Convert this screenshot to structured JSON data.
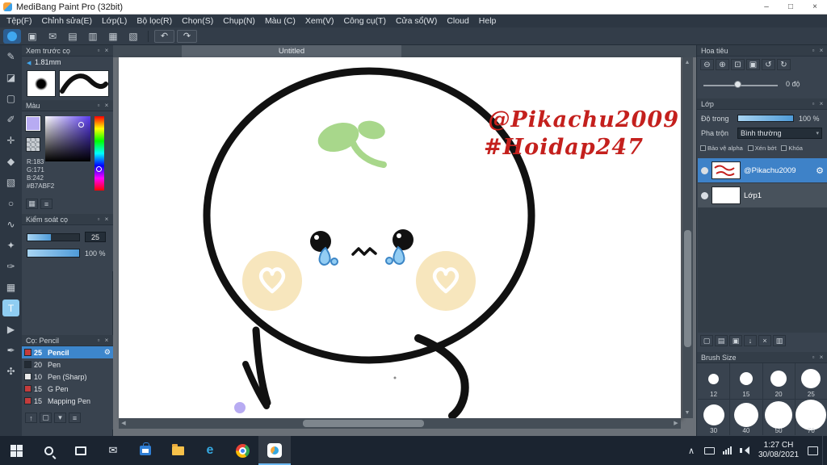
{
  "app": {
    "title": "MediBang Paint Pro (32bit)"
  },
  "icons": {
    "min": "–",
    "max": "□",
    "close": "×",
    "popout": "▫",
    "save": "▣",
    "chat": "✉",
    "doc": "▤",
    "doc2": "▥",
    "grid": "▦",
    "material": "▧",
    "undo": "↶",
    "redo": "↷",
    "collapse": "◀",
    "palette": "▦",
    "sliders": "≡",
    "gear": "⚙",
    "zoom_out": "⊖",
    "zoom_in": "⊕",
    "zoom_fit": "⊡",
    "zoom_reset": "▣",
    "rotate_ccw": "↺",
    "rotate_cw": "↻",
    "dd_arrow": "▾",
    "l_new": "▢",
    "l_folder": "▤",
    "l_dup": "▣",
    "l_merge": "↓",
    "l_trash": "×",
    "l_menu": "▥",
    "b_up": "↑",
    "b_new": "▢",
    "b_menu": "▾",
    "b_list": "≡",
    "mail": "✉",
    "edge": "e",
    "chevron": "∧",
    "sb_left": "◀",
    "sb_right": "▶",
    "sb_up": "▲",
    "sb_down": "▼"
  },
  "menubar": {
    "items": [
      "Tệp(F)",
      "Chỉnh sửa(E)",
      "Lớp(L)",
      "Bộ lọc(R)",
      "Chọn(S)",
      "Chụp(N)",
      "Màu (C)",
      "Xem(V)",
      "Công cụ(T)",
      "Cửa sổ(W)",
      "Cloud",
      "Help"
    ]
  },
  "toolstrip": {
    "tools": [
      "✎",
      "◪",
      "▢",
      "✐",
      "✛",
      "◆",
      "▧",
      "○",
      "∿",
      "✦",
      "✑",
      "▦",
      "T",
      "▶",
      "✒",
      "✣"
    ]
  },
  "left": {
    "brush_preview": {
      "title": "Xem trước cọ",
      "size": "1.81mm"
    },
    "color": {
      "title": "Màu",
      "r": "R:183",
      "g": "G:171",
      "b": "B:242",
      "hex": "#B7ABF2"
    },
    "brush_control": {
      "title": "Kiểm soát cọ",
      "size": "25",
      "opacity": "100 %"
    },
    "brushes": {
      "title": "Cọ: Pencil",
      "items": [
        {
          "size": "25",
          "name": "Pencil",
          "chip": "#c43c3c",
          "selected": true
        },
        {
          "size": "20",
          "name": "Pen",
          "chip": "#232b34",
          "selected": false
        },
        {
          "size": "10",
          "name": "Pen (Sharp)",
          "chip": "#e9e9e9",
          "selected": false
        },
        {
          "size": "15",
          "name": "G Pen",
          "chip": "#c43c3c",
          "selected": false
        },
        {
          "size": "15",
          "name": "Mapping Pen",
          "chip": "#c43c3c",
          "selected": false
        }
      ]
    }
  },
  "canvas": {
    "tab": "Untitled",
    "annotations": [
      "@Pikachu2009",
      "#Hoidap247"
    ]
  },
  "right": {
    "navigator": {
      "title": "Hoa tiêu",
      "rotation": "0 độ"
    },
    "layers": {
      "title": "Lớp",
      "opacity_label": "Độ trong",
      "opacity_value": "100 %",
      "blend_label": "Pha trộn",
      "blend_value": "Bình thường",
      "checks": [
        "Bảo vệ alpha",
        "Xén bớt",
        "Khóa"
      ],
      "items": [
        {
          "name": "@Pikachu2009",
          "selected": true
        },
        {
          "name": "Lớp1",
          "selected": false
        }
      ]
    },
    "brush_size": {
      "title": "Brush Size",
      "sizes": [
        "12",
        "15",
        "20",
        "25",
        "30",
        "40",
        "50",
        "70"
      ]
    }
  },
  "taskbar": {
    "time": "1:27 CH",
    "date": "30/08/2021"
  },
  "colors": {
    "accent_blue": "#3fa7f0",
    "selection_blue": "#3d86cc",
    "foreground_color": "#b7abf2",
    "annotation_red": "#c4201d",
    "cheek": "#f7e6bd",
    "sprout_green": "#a8d78b"
  }
}
